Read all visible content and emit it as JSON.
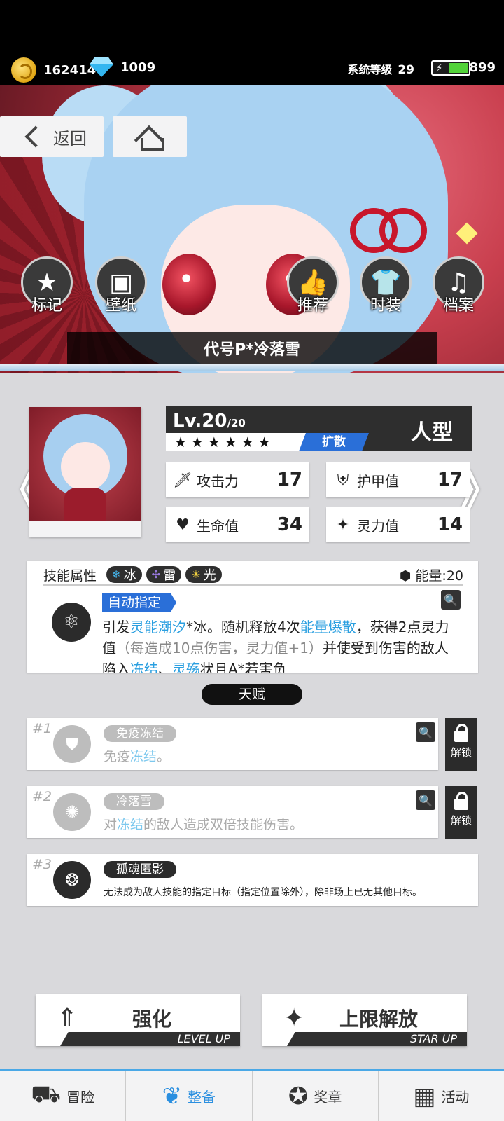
{
  "resources": {
    "coins": "162414",
    "gems": "1009"
  },
  "system": {
    "label": "系统等级",
    "level": "29",
    "energy": "899"
  },
  "nav": {
    "back_label": "返回"
  },
  "hero_actions": [
    {
      "label": "标记",
      "icon": "star-icon"
    },
    {
      "label": "壁纸",
      "icon": "image-icon"
    },
    {
      "label": "推荐",
      "icon": "thumbs-up-icon"
    },
    {
      "label": "时装",
      "icon": "shirt-icon"
    },
    {
      "label": "档案",
      "icon": "archive-icon"
    }
  ],
  "character": {
    "name": "代号P*冷落雪",
    "level": "Lv.20",
    "level_max": "/20",
    "stars": "★★★★★★",
    "role": "扩散",
    "type": "人型",
    "stats": {
      "attack": {
        "label": "攻击力",
        "value": "17"
      },
      "armor": {
        "label": "护甲值",
        "value": "17"
      },
      "hp": {
        "label": "生命值",
        "value": "34"
      },
      "spirit": {
        "label": "灵力值",
        "value": "14"
      }
    }
  },
  "skill": {
    "attr_label": "技能属性",
    "elements": [
      "冰",
      "雷",
      "光"
    ],
    "energy": "能量:20",
    "auto_tag": "自动指定",
    "desc_1": "引发",
    "desc_hl_1": "灵能潮汐",
    "desc_2": "*冰。随机释放4次",
    "desc_hl_2": "能量爆散",
    "desc_3": "，获得2点灵力值",
    "desc_gray": "（每造成10点伤害，灵力值+1）",
    "desc_4": "并使受到伤害的敌人陷入",
    "desc_hl_3": "冻结",
    "desc_5": "、",
    "desc_hl_4": "灵殇",
    "desc_6": "状且A*若害负"
  },
  "talent": {
    "title": "天赋",
    "items": [
      {
        "num": "#1",
        "name": "免疫冻结",
        "desc_pre": "免疫",
        "desc_hl": "冻结",
        "desc_post": "。",
        "lock_label": "解锁"
      },
      {
        "num": "#2",
        "name": "冷落雪",
        "desc_pre": "对",
        "desc_hl": "冻结",
        "desc_post": "的敌人造成双倍技能伤害。",
        "lock_label": "解锁"
      },
      {
        "num": "#3",
        "name": "孤魂匿影",
        "desc": "无法成为敌人技能的指定目标（指定位置除外），除非场上已无其他目标。"
      }
    ]
  },
  "actions": {
    "strengthen": {
      "label": "强化",
      "sub": "LEVEL UP"
    },
    "limit_break": {
      "label": "上限解放",
      "sub": "STAR UP"
    }
  },
  "bottom_nav": [
    {
      "label": "冒险",
      "active": false
    },
    {
      "label": "整备",
      "active": true
    },
    {
      "label": "奖章",
      "active": false
    },
    {
      "label": "活动",
      "active": false
    }
  ]
}
